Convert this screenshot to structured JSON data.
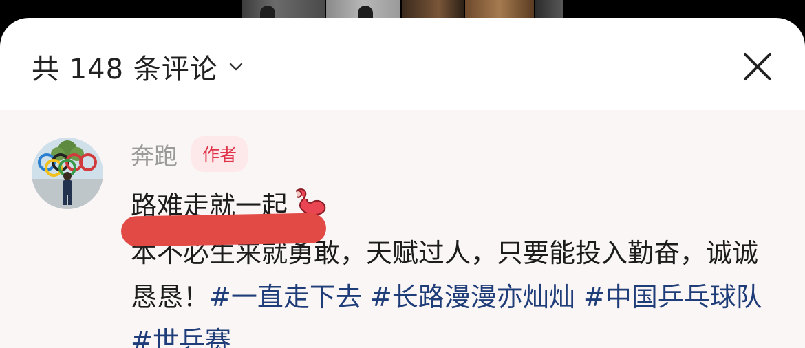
{
  "header": {
    "comment_count_label": "共 148 条评论"
  },
  "comment": {
    "author": "奔跑",
    "author_badge": "作者",
    "title": "路难走就一起",
    "body_prefix": "本不必生来就勇敢，天赋过人，只要能投入勤奋，诚诚恳恳！",
    "hashtags": [
      "#一直走下去",
      "#长路漫漫亦灿灿",
      "#中国乒乓球队",
      "#世乒赛"
    ]
  },
  "icons": {
    "dropdown": "chevron-down-icon",
    "close": "close-icon",
    "emoji": "flexed-biceps-icon"
  },
  "colors": {
    "badge_text": "#e0334a",
    "badge_bg": "#fde9ea",
    "hashtag": "#1f3d79",
    "redaction": "#e24a45"
  }
}
